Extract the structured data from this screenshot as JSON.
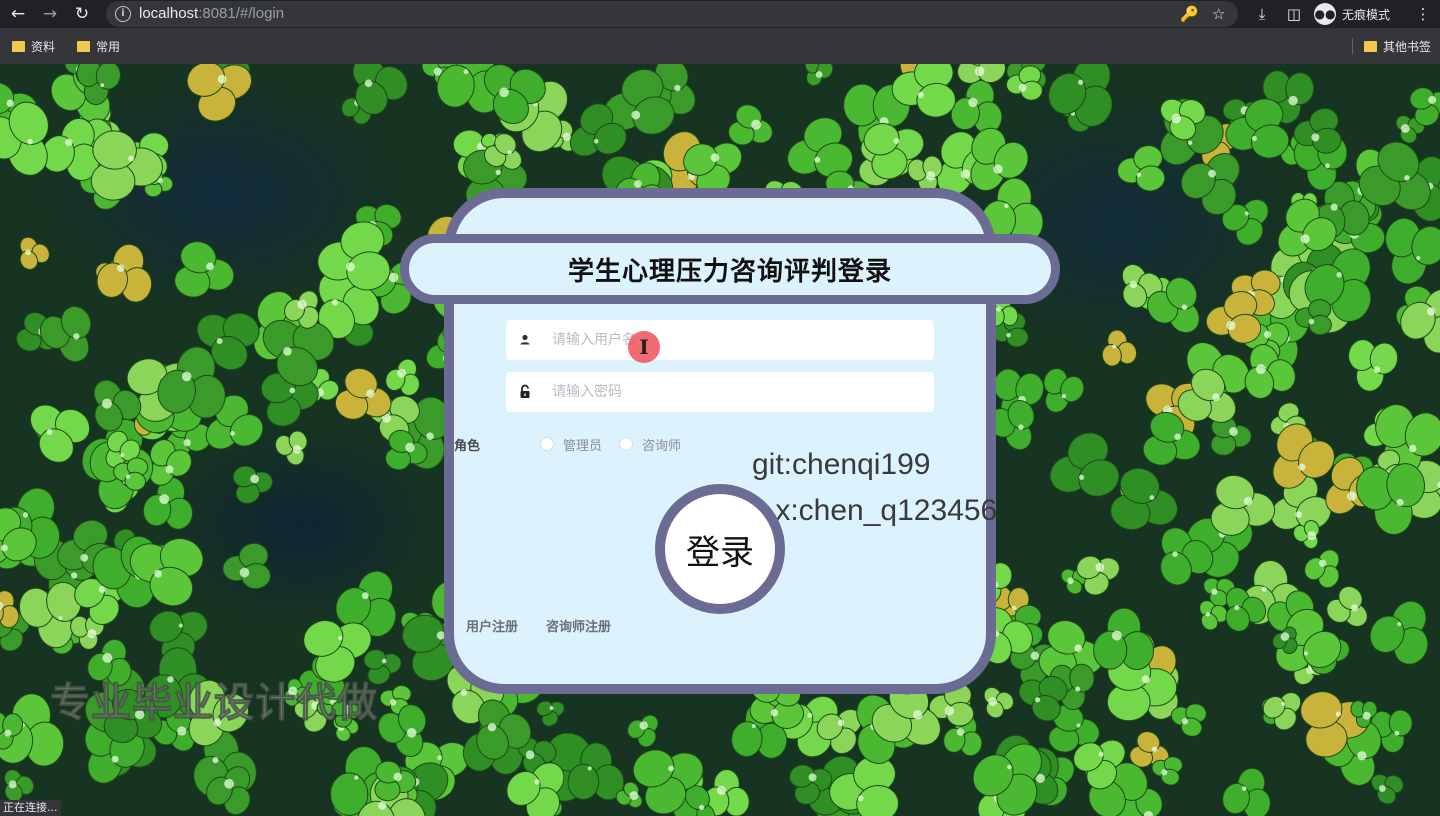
{
  "browser": {
    "url_host": "localhost",
    "url_rest": ":8081/#/login",
    "incognito_label": "无痕模式",
    "bookmarks": [
      "资料",
      "常用"
    ],
    "other_bookmarks": "其他书签",
    "status_text": "正在连接..."
  },
  "login": {
    "title": "学生心理压力咨询评判登录",
    "username_placeholder": "请输入用户名",
    "password_placeholder": "请输入密码",
    "role_label": "角色",
    "roles": [
      "管理员",
      "咨询师"
    ],
    "login_button": "登录",
    "user_register": "用户注册",
    "counselor_register": "咨询师注册"
  },
  "overlay": {
    "git": "git:chenqi199",
    "wx": "v x:chen_q123456",
    "watermark": "专业毕业设计代做"
  },
  "colors": {
    "card_bg": "#dcf2fd",
    "card_border": "#6b6b93"
  }
}
